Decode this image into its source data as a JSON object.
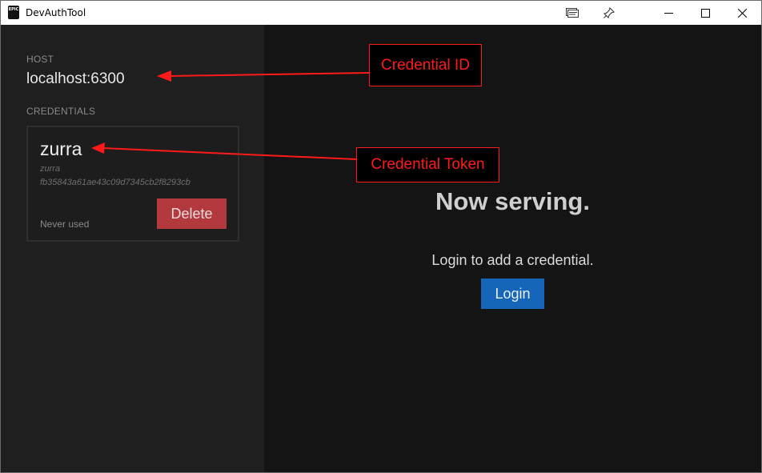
{
  "window": {
    "title": "DevAuthTool",
    "app_icon_text": "EPIC",
    "controls": [
      "minimize-icon",
      "maximize-icon",
      "close-icon"
    ],
    "extra_icons": [
      "tabs-icon",
      "pin-icon"
    ]
  },
  "sidebar": {
    "host_label": "HOST",
    "host_value": "localhost:6300",
    "credentials_label": "CREDENTIALS",
    "credentials": [
      {
        "name": "zurra",
        "account": "zurra",
        "token": "fb35843a61ae43c09d7345cb2f8293cb",
        "status": "Never used",
        "delete_label": "Delete"
      }
    ]
  },
  "main": {
    "heading": "Now serving.",
    "hint": "Login to add a credential.",
    "login_label": "Login"
  },
  "annotations": {
    "callout_1": "Credential ID",
    "callout_2": "Credential Token",
    "color": "#ff1a1a"
  },
  "colors": {
    "sidebar_bg": "#1f1f1f",
    "main_bg": "#141414",
    "delete": "#b23a3e",
    "login": "#1565b8"
  }
}
